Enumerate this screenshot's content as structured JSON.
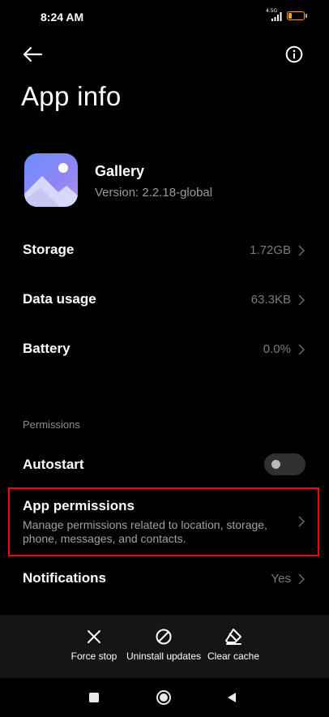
{
  "status_bar": {
    "time": "8:24 AM",
    "network_label": "4.5G",
    "battery_level": "22",
    "battery_color": "#e8a33a",
    "battery_fill_percent": 22
  },
  "header": {
    "back_icon": "arrow-left-icon",
    "info_icon": "info-circle-icon",
    "title": "App info"
  },
  "app": {
    "icon": "gallery-app-icon",
    "name": "Gallery",
    "version": "Version: 2.2.18-global"
  },
  "rows": [
    {
      "label": "Storage",
      "value": "1.72GB"
    },
    {
      "label": "Data usage",
      "value": "63.3KB"
    },
    {
      "label": "Battery",
      "value": "0.0%"
    }
  ],
  "permissions_section": {
    "header": "Permissions",
    "autostart": {
      "label": "Autostart",
      "enabled": false
    },
    "app_permissions": {
      "title": "App permissions",
      "description": "Manage permissions related to location, storage, phone, messages, and contacts.",
      "highlight_color": "#ff0000"
    },
    "notifications": {
      "label": "Notifications",
      "value": "Yes"
    }
  },
  "actions": [
    {
      "label": "Force stop",
      "icon": "close-icon"
    },
    {
      "label": "Uninstall updates",
      "icon": "prohibited-icon"
    },
    {
      "label": "Clear cache",
      "icon": "eraser-icon"
    }
  ],
  "nav_bar": {
    "recents_icon": "square-icon",
    "home_icon": "circle-icon",
    "back_icon": "triangle-back-icon"
  }
}
